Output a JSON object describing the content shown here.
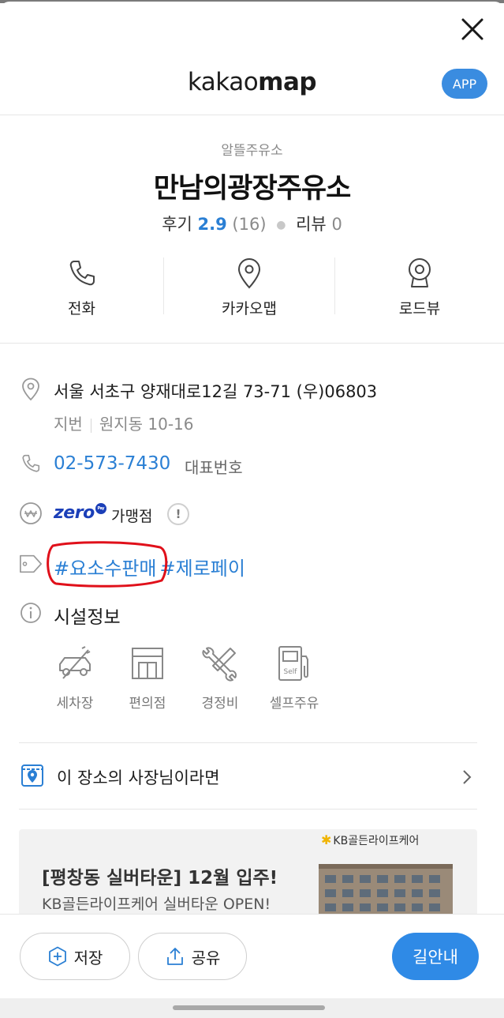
{
  "header": {
    "logo_light": "kakao",
    "logo_bold": "map",
    "app_button": "APP"
  },
  "place": {
    "category": "알뜰주유소",
    "name": "만남의광장주유소",
    "rating_label": "후기",
    "rating_score": "2.9",
    "rating_count": "(16)",
    "review_label": "리뷰",
    "review_count": "0"
  },
  "actions": [
    {
      "label": "전화",
      "icon": "phone-icon"
    },
    {
      "label": "카카오맵",
      "icon": "map-pin-icon"
    },
    {
      "label": "로드뷰",
      "icon": "roadview-icon"
    }
  ],
  "info": {
    "address": "서울 서초구 양재대로12길 73-71 (우)06803",
    "lot_label": "지번",
    "lot_address": "원지동 10-16",
    "phone": "02-573-7430",
    "phone_desc": "대표번호",
    "zero_logo": "zero",
    "zero_pay_badge": "Pay",
    "merchant_label": "가맹점",
    "notice_symbol": "!",
    "tags": [
      "#요소수판매",
      "#제로페이"
    ],
    "facility_title": "시설정보"
  },
  "facilities": [
    {
      "label": "세차장",
      "icon": "car-wash-icon"
    },
    {
      "label": "편의점",
      "icon": "convenience-store-icon"
    },
    {
      "label": "경정비",
      "icon": "repair-tools-icon"
    },
    {
      "label": "셀프주유",
      "icon": "self-fuel-icon"
    }
  ],
  "owner": {
    "label": "이 장소의 사장님이라면"
  },
  "banner": {
    "brand": "KB골든라이프케어",
    "title": "[평창동 실버타운] 12월 입주!",
    "subtitle": "KB골든라이프케어 실버타운 OPEN!"
  },
  "bottom": {
    "save_label": "저장",
    "share_label": "공유",
    "route_label": "길안내"
  },
  "colors": {
    "accent_blue": "#2a7fd4",
    "route_button": "#2f8ae6",
    "app_button": "#3a8ce0",
    "annotation_red": "#e0101a",
    "zero_pay_blue": "#1b3fb8"
  }
}
